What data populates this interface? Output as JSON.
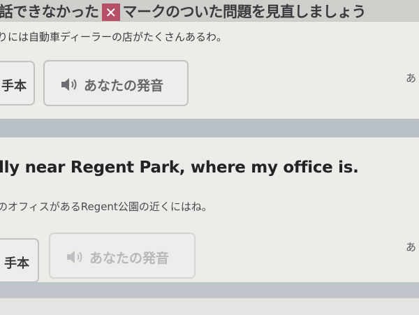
{
  "header": {
    "message_before": "話できなかった",
    "x_mark": "✕",
    "message_after": "マークのついた問題を見直しましょう"
  },
  "card1": {
    "jp_text": "りには自動車ディーラーの店がたくさんあるわ。",
    "model_button_label": "手本",
    "voice_button_label": "あなたの発音",
    "right_text": "あ"
  },
  "card2": {
    "english_text": "lly near Regent Park, where my office is.",
    "jp_translation": "のオフィスがあるRegent公園の近くにはね。",
    "model_button_label": "手本",
    "voice_button_label": "あなたの発音",
    "right_text": "あ"
  },
  "icons": {
    "speaker": "speaker-icon",
    "x_mark": "x-mark-icon"
  },
  "colors": {
    "x_badge": "#b64f68",
    "card_bg": "#ecece9",
    "divider": "#b9c0c7"
  }
}
